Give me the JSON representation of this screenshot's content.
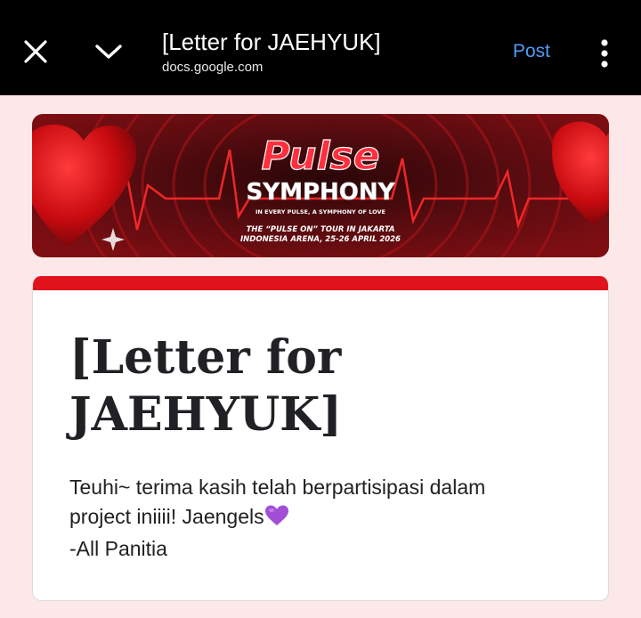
{
  "topbar": {
    "title": "[Letter for JAEHYUK]",
    "url": "docs.google.com",
    "post_label": "Post"
  },
  "banner": {
    "title_line1": "Pulse",
    "title_line2": "SYMPHONY",
    "tagline": "IN EVERY PULSE, A SYMPHONY OF LOVE",
    "tour_line1": "THE “PULSE ON” TOUR IN JAKARTA",
    "tour_line2": "INDONESIA ARENA, 25-26 APRIL 2026"
  },
  "form": {
    "title": "[Letter for JAEHYUK]",
    "desc_line1": "Teuhi~ terima kasih telah berpartisipasi dalam",
    "desc_line2": "project iniiii! Jaengels",
    "desc_line3": "-All Panitia"
  },
  "colors": {
    "accent": "#e0131c",
    "link": "#4f9cf7",
    "page_bg": "#fce8e9"
  },
  "icons": [
    "close-icon",
    "chevron-down-icon",
    "more-vert-icon",
    "purple-heart-icon"
  ]
}
